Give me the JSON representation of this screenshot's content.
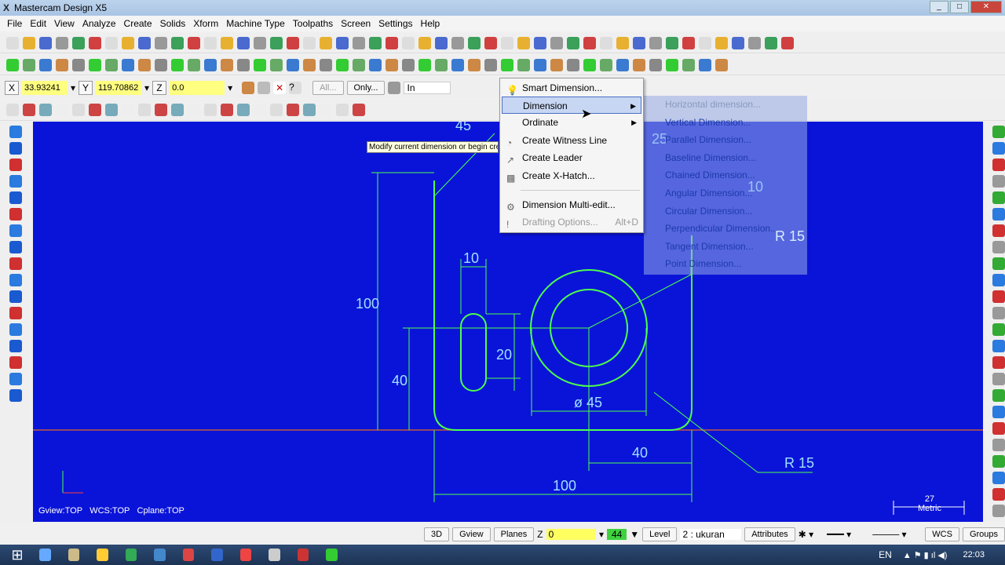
{
  "window": {
    "title": "Mastercam Design X5",
    "logo": "X"
  },
  "menubar": [
    "File",
    "Edit",
    "View",
    "Analyze",
    "Create",
    "Solids",
    "Xform",
    "Machine Type",
    "Toolpaths",
    "Screen",
    "Settings",
    "Help"
  ],
  "coords": {
    "x_label": "X",
    "x_value": "33.93241",
    "y_label": "Y",
    "y_value": "119.70862",
    "z_label": "Z",
    "z_value": "0.0",
    "all_label": "All...",
    "only_label": "Only...",
    "in_value": "In"
  },
  "menu": {
    "items": [
      {
        "label": "Smart Dimension...",
        "icon": "lightbulb-icon"
      },
      {
        "label": "Dimension",
        "submenu": true,
        "selected": true
      },
      {
        "label": "Ordinate",
        "submenu": true
      },
      {
        "label": "Create Witness Line",
        "icon": "witness-line-icon"
      },
      {
        "label": "Create Leader",
        "icon": "leader-icon"
      },
      {
        "label": "Create X-Hatch...",
        "icon": "hatch-icon"
      },
      {
        "label": "Dimension Multi-edit...",
        "icon": "multi-edit-icon"
      },
      {
        "label": "Drafting Options...",
        "shortcut": "Alt+D",
        "disabled": true
      }
    ]
  },
  "submenu": [
    "Horizontal dimension...",
    "Vertical Dimension...",
    "Parallel Dimension...",
    "Baseline Dimension...",
    "Chained Dimension...",
    "Angular Dimension...",
    "Circular Dimension...",
    "Perpendicular Dimension...",
    "Tangent Dimension...",
    "Point Dimension..."
  ],
  "tooltip": "Modify current dimension or begin cre",
  "drawing": {
    "dims": [
      "45",
      "25",
      "10",
      "R 15",
      "10",
      "100",
      "20",
      "40",
      "ø 45",
      "40",
      "100",
      "R 15"
    ]
  },
  "viewport": {
    "gview": "Gview:TOP",
    "wcs": "WCS:TOP",
    "cplane": "Cplane:TOP",
    "scale_value": "27",
    "units": "Metric"
  },
  "statusbar": {
    "3d": "3D",
    "gview": "Gview",
    "planes": "Planes",
    "z_label": "Z",
    "z_value": "0",
    "color_value": "44",
    "level_label": "Level",
    "level_value": "2 : ukuran",
    "attributes": "Attributes",
    "wcs": "WCS",
    "groups": "Groups"
  },
  "taskbar": {
    "lang": "EN",
    "time": "22:03"
  },
  "colors": {
    "canvas": "#0a14d8",
    "geometry": "#4cff4c",
    "menu_highlight": "#c7d6f3"
  }
}
